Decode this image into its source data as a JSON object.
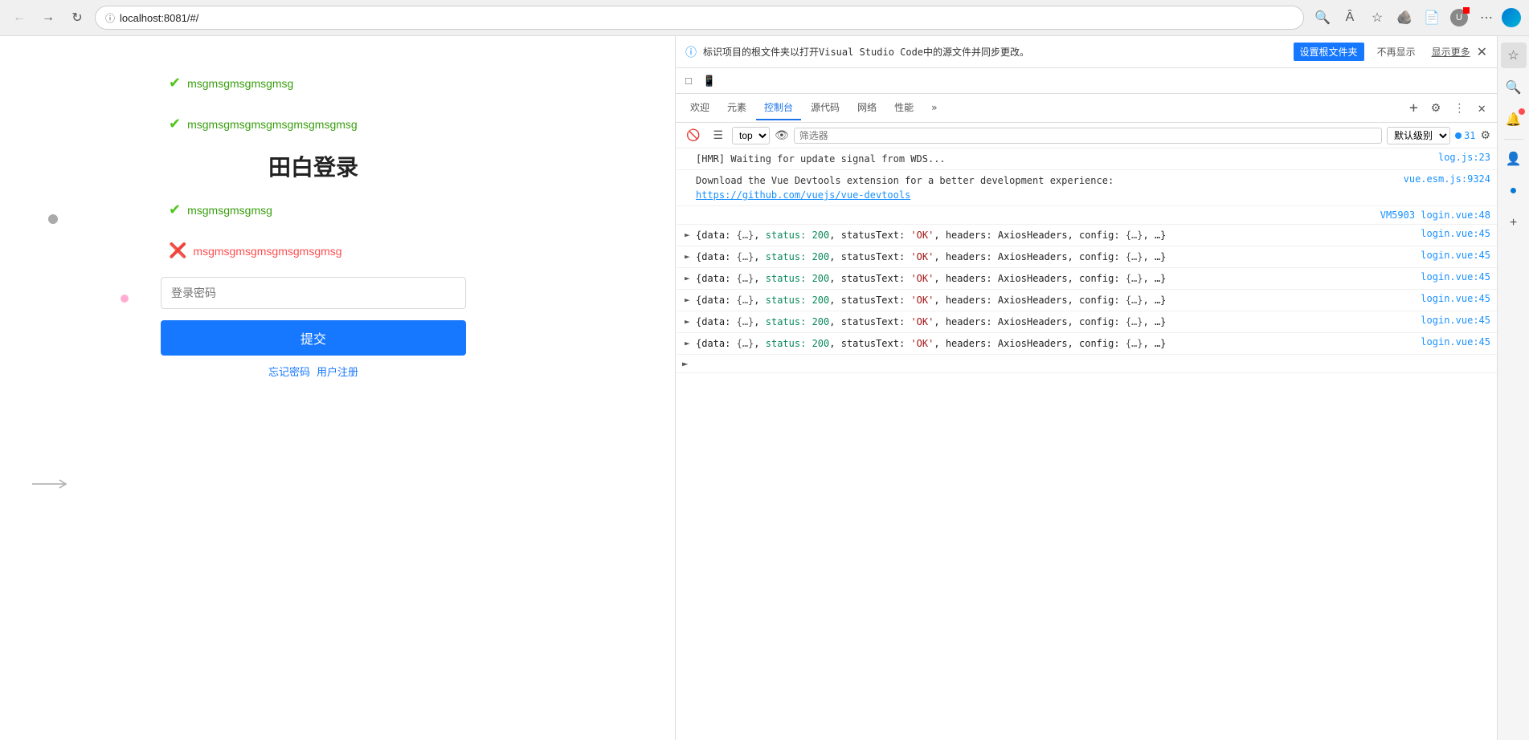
{
  "browser": {
    "url": "localhost:8081/#/",
    "back_disabled": true,
    "forward_disabled": false
  },
  "page": {
    "messages": [
      {
        "type": "success",
        "text": "msgmsgmsgmsgmsg"
      },
      {
        "type": "success",
        "text": "msgmsgmsgmsgmsgmsgmsgmsg"
      },
      {
        "type": "success",
        "text": "msgmsgmsgmsg"
      },
      {
        "type": "error",
        "text": "msgmsgmsgmsgmsgmsgmsg"
      }
    ],
    "title": "田白登录",
    "password_placeholder": "登录密码",
    "submit_label": "提交",
    "forgot_password": "忘记密码",
    "register": "用户注册"
  },
  "devtools": {
    "notification": {
      "text": "标识项目的根文件夹以打开Visual Studio Code中的源文件并同步更改。",
      "btn1": "设置根文件夹",
      "btn2": "不再显示",
      "more": "显示更多"
    },
    "tabs": [
      {
        "label": "欢迎",
        "active": false
      },
      {
        "label": "元素",
        "active": false
      },
      {
        "label": "控制台",
        "active": true
      },
      {
        "label": "源代码",
        "active": false
      },
      {
        "label": "网络",
        "active": false
      },
      {
        "label": "性能",
        "active": false
      }
    ],
    "toolbar": {
      "top_value": "top",
      "filter_placeholder": "筛选器",
      "level_label": "默认级别",
      "error_count": "31"
    },
    "console_lines": [
      {
        "type": "info",
        "has_arrow": false,
        "text": "[HMR] Waiting for update signal from WDS...",
        "link_text": "log.js:23",
        "link_href": "log.js:23"
      },
      {
        "type": "info",
        "has_arrow": false,
        "text": "Download the Vue Devtools extension for a better development experience:",
        "url": "https://github.com/vuejs/vue-devtools",
        "link_text": "vue.esm.js:9324"
      },
      {
        "type": "info",
        "has_arrow": false,
        "text": "",
        "link_text": "VM5903 login.vue:48"
      },
      {
        "type": "info",
        "has_arrow": true,
        "text": "{data: {…}, status: 200, statusText: 'OK', headers: AxiosHeaders, config: {…}, …}",
        "link_text": "login.vue:45"
      },
      {
        "type": "info",
        "has_arrow": true,
        "text": "{data: {…}, status: 200, statusText: 'OK', headers: AxiosHeaders, config: {…}, …}",
        "link_text": "login.vue:45"
      },
      {
        "type": "info",
        "has_arrow": true,
        "text": "{data: {…}, status: 200, statusText: 'OK', headers: AxiosHeaders, config: {…}, …}",
        "link_text": "login.vue:45"
      },
      {
        "type": "info",
        "has_arrow": true,
        "text": "{data: {…}, status: 200, statusText: 'OK', headers: AxiosHeaders, config: {…}, …}",
        "link_text": "login.vue:45"
      },
      {
        "type": "info",
        "has_arrow": true,
        "text": "{data: {…}, status: 200, statusText: 'OK', headers: AxiosHeaders, config: {…}, …}",
        "link_text": "login.vue:45"
      },
      {
        "type": "info",
        "has_arrow": true,
        "text": "{data: {…}, status: 200, statusText: 'OK', headers: AxiosHeaders, config: {…}, …}",
        "link_text": "login.vue:45"
      }
    ]
  }
}
